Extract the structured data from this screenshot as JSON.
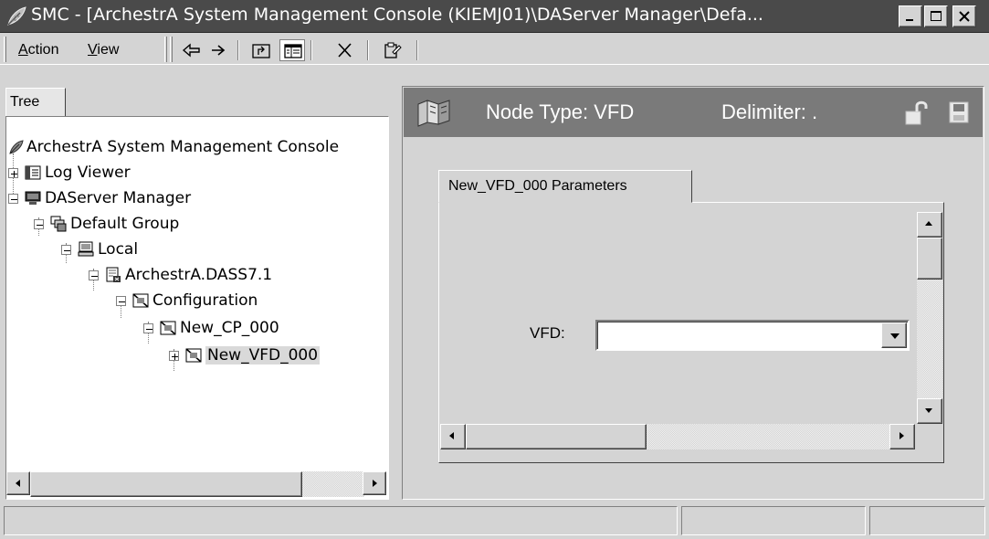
{
  "window": {
    "title": "SMC - [ArchestrA System Management Console (KIEMJ01)\\DAServer Manager\\Defa...",
    "controls": [
      "minimize-icon",
      "maximize-icon",
      "close-icon"
    ]
  },
  "menu": {
    "items": [
      {
        "label": "Action",
        "accel": "A",
        "rest": "ction"
      },
      {
        "label": "View",
        "accel": "V",
        "rest": "iew"
      }
    ]
  },
  "toolbar": {
    "buttons": [
      "back-arrow-icon",
      "forward-arrow-icon",
      "up-folder-icon",
      "show-hide-tree-icon",
      "delete-icon",
      "properties-icon"
    ]
  },
  "tree": {
    "tab_label": "Tree",
    "nodes": [
      {
        "label": "ArchestrA System Management Console",
        "icon": "smc-leaf-icon",
        "depth": 0,
        "expander": "none"
      },
      {
        "label": "Log Viewer",
        "icon": "log-viewer-icon",
        "depth": 1,
        "expander": "plus"
      },
      {
        "label": "DAServer Manager",
        "icon": "daserver-manager-icon",
        "depth": 1,
        "expander": "minus"
      },
      {
        "label": "Default Group",
        "icon": "group-icon",
        "depth": 2,
        "expander": "minus"
      },
      {
        "label": "Local",
        "icon": "computer-icon",
        "depth": 3,
        "expander": "minus"
      },
      {
        "label": "ArchestrA.DASS7.1",
        "icon": "daserver-icon",
        "depth": 4,
        "expander": "minus"
      },
      {
        "label": "Configuration",
        "icon": "configuration-icon",
        "depth": 5,
        "expander": "minus"
      },
      {
        "label": "New_CP_000",
        "icon": "device-icon",
        "depth": 6,
        "expander": "minus"
      },
      {
        "label": "New_VFD_000",
        "icon": "device-icon",
        "depth": 7,
        "expander": "plus",
        "selected": true
      }
    ]
  },
  "detail": {
    "node_type": "Node Type: VFD",
    "delimiter": "Delimiter: .",
    "header_icon": "node-hierarchy-icon",
    "tab_label": "New_VFD_000 Parameters",
    "field_label": "VFD:",
    "field_value": ""
  },
  "statusbar": {
    "cells": [
      "",
      "",
      ""
    ]
  }
}
